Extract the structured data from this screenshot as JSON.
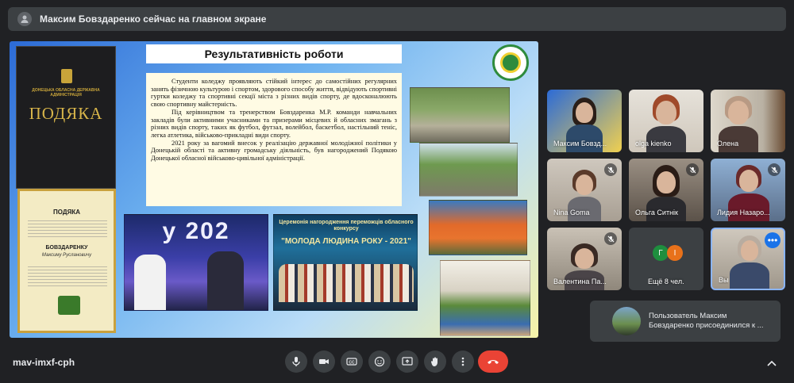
{
  "top_banner": {
    "text": "Максим Бовздаренко сейчас на главном экране"
  },
  "slide": {
    "title": "Результативність роботи",
    "cert_dark_org": "ДОНЕЦЬКА ОБЛАСНА ДЕРЖАВНА АДМІНІСТРАЦІЯ",
    "cert_dark_word": "ПОДЯКА",
    "cert_light_word": "ПОДЯКА",
    "cert_light_recipient": "БОВЗДАРЕНКУ",
    "cert_light_name": "Максиму Руслановичу",
    "paragraphs": [
      "Студенти коледжу проявляють стійкий інтерес до самостійних регулярних занять фізичною культурою і спортом, здорового способу життя, відвідують спортивні гуртки коледжу та спортивні секції міста з різних видів спорту, де вдосконалюють свою спортивну майстерність.",
      "Під керівництвом та тренерством Бовздаренка М.Р. команди навчальних закладів були активними учасниками та призерами місцевих й обласних змагань з різних видів спорту, таких як футбол, футзал, волейбол, баскетбол, настільний теніс, легка атлетика, військово-прикладні види спорту.",
      "2021 року за вагомий внесок у реалізацію державної молодіжної політики у Донецькій області та активну громадську діяльність, був нагороджений Подякою Донецької обласної військово-цивільної адміністрації."
    ],
    "photo1_text": "у 202",
    "photo2_header": "Церемонія нагородження переможців обласного конкурсу",
    "photo2_title": "\"МОЛОДА ЛЮДИНА РОКУ - 2021\""
  },
  "participants": [
    {
      "name": "Максим Бовзд...",
      "muted": false
    },
    {
      "name": "olga kienko",
      "muted": false
    },
    {
      "name": "Олена",
      "muted": false
    },
    {
      "name": "Nina Goma",
      "muted": true
    },
    {
      "name": "Ольга Ситнік",
      "muted": true
    },
    {
      "name": "Лидия Назаро...",
      "muted": true
    },
    {
      "name": "Валентина Па...",
      "muted": true
    },
    {
      "name": "Ещё 8 чел.",
      "muted": false,
      "avatars": [
        "Г",
        "І"
      ],
      "avatar_colors": [
        "#1e8e3e",
        "#e8711a"
      ]
    },
    {
      "name": "Вы",
      "muted": false,
      "self": true
    }
  ],
  "toast": {
    "message": "Пользователь Максим Бовздаренко присоединился к ..."
  },
  "bottom_bar": {
    "meeting_code": "mav-imxf-cph",
    "controls": [
      "microphone-icon",
      "camera-icon",
      "captions-icon",
      "emoji-icon",
      "present-screen-icon",
      "raise-hand-icon",
      "more-options-icon",
      "end-call-icon"
    ]
  },
  "colors": {
    "background": "#202124",
    "tile": "#3c4043",
    "end_call": "#ea4335",
    "accent": "#1a73e8"
  }
}
